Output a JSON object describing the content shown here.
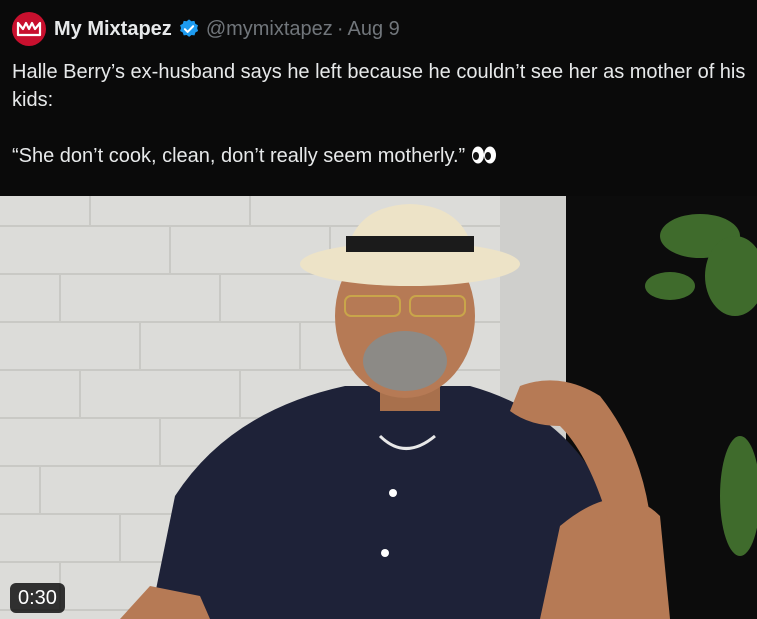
{
  "author": {
    "display_name": "My Mixtapez",
    "handle": "@mymixtapez",
    "separator": "·",
    "time": "Aug 9",
    "avatar_icon": "mixtapez-crown-logo",
    "verified_icon": "verified-badge-icon",
    "brand_color": "#c8102e",
    "verified_color": "#1d9bf0"
  },
  "tweet": {
    "line1": "Halle Berry’s ex-husband says he left because he couldn’t see her as mother of his kids:",
    "line2": "“She don’t cook, clean, don’t really seem motherly.”",
    "emoji_icon": "eyes-emoji-icon"
  },
  "media": {
    "type": "video",
    "duration": "0:30"
  }
}
